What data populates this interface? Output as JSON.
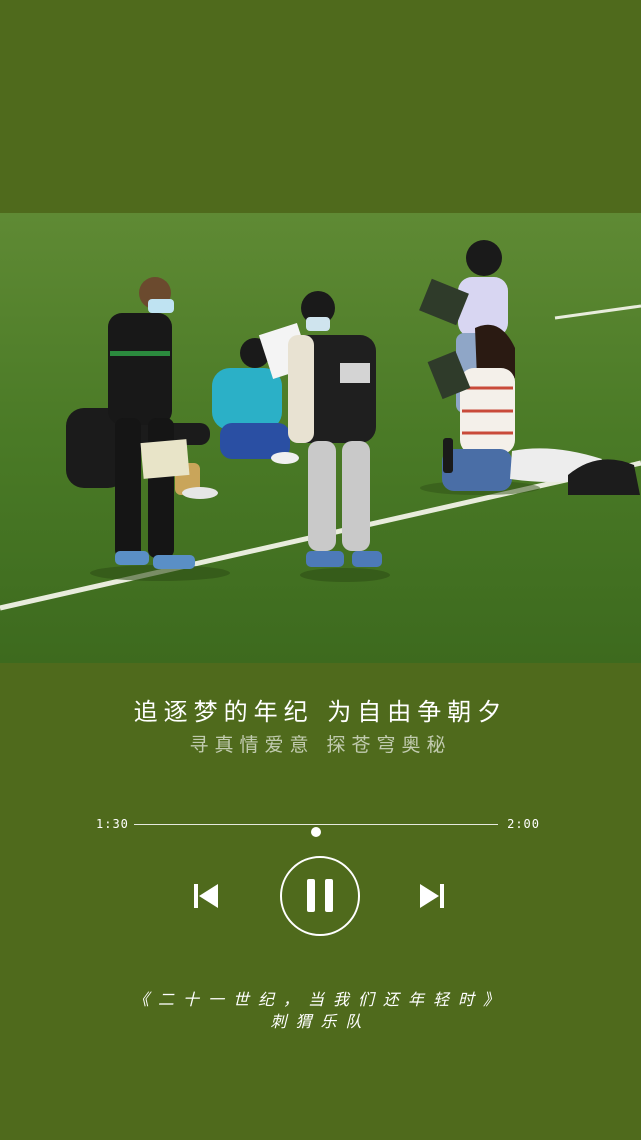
{
  "photo": {
    "icon": "photo-students-on-field"
  },
  "lyrics": {
    "line1": "追逐梦的年纪 为自由争朝夕",
    "line2": "寻真情爱意 探苍穹奥秘"
  },
  "player": {
    "current_time": "1:30",
    "total_time": "2:00",
    "progress": 0.5,
    "prev_icon": "previous-track-icon",
    "pause_icon": "pause-icon",
    "next_icon": "next-track-icon"
  },
  "song": {
    "title": "《二十一世纪，当我们还年轻时》",
    "artist": "刺猬乐队"
  },
  "colors": {
    "background": "#4f6a1c",
    "text": "#ffffff"
  }
}
